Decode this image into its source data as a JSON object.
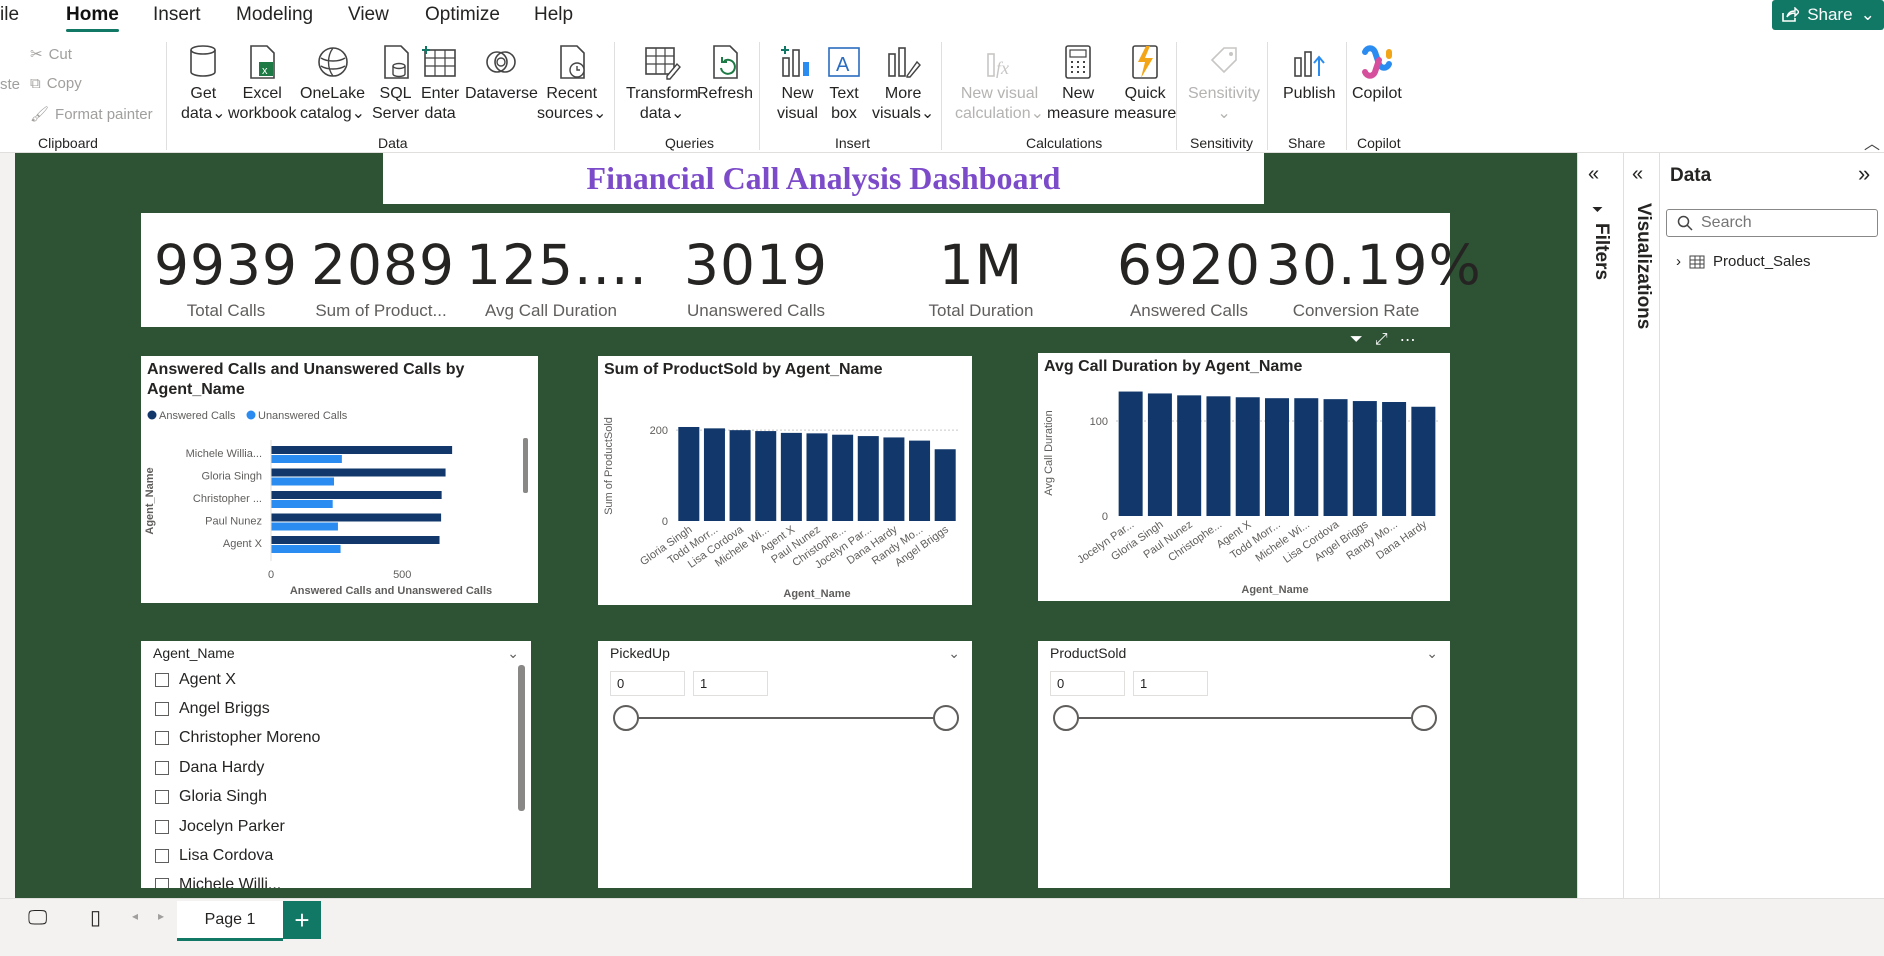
{
  "menu": {
    "file": "ile",
    "items": [
      "Home",
      "Insert",
      "Modeling",
      "View",
      "Optimize",
      "Help"
    ],
    "share": "Share"
  },
  "ribbon": {
    "clipboard": {
      "paste": "ste",
      "cut": "Cut",
      "copy": "Copy",
      "format_painter": "Format painter",
      "group": "Clipboard"
    },
    "data": {
      "get_data": [
        "Get",
        "data"
      ],
      "excel": [
        "Excel",
        "workbook"
      ],
      "onelake": [
        "OneLake",
        "catalog"
      ],
      "sql": [
        "SQL",
        "Server"
      ],
      "enter": [
        "Enter",
        "data"
      ],
      "dataverse": "Dataverse",
      "recent": [
        "Recent",
        "sources"
      ],
      "group": "Data"
    },
    "queries": {
      "transform": [
        "Transform",
        "data"
      ],
      "refresh": "Refresh",
      "group": "Queries"
    },
    "insert": {
      "new_visual": [
        "New",
        "visual"
      ],
      "text_box": [
        "Text",
        "box"
      ],
      "more_visuals": [
        "More",
        "visuals"
      ],
      "group": "Insert"
    },
    "calculations": {
      "new_visual_calc": [
        "New visual",
        "calculation"
      ],
      "new_measure": [
        "New",
        "measure"
      ],
      "quick_measure": [
        "Quick",
        "measure"
      ],
      "group": "Calculations"
    },
    "sensitivity": {
      "label": "Sensitivity",
      "group": "Sensitivity"
    },
    "share": {
      "publish": "Publish",
      "group": "Share"
    },
    "copilot": {
      "label": "Copilot",
      "group": "Copilot"
    }
  },
  "dashboard": {
    "title": "Financial Call Analysis Dashboard",
    "kpis": [
      {
        "value": "9939",
        "label": "Total Calls"
      },
      {
        "value": "2089",
        "label": "Sum of Product..."
      },
      {
        "value": "125....",
        "label": "Avg Call Duration"
      },
      {
        "value": "3019",
        "label": "Unanswered Calls"
      },
      {
        "value": "1M",
        "label": "Total Duration"
      },
      {
        "value": "6920",
        "label": "Answered Calls"
      },
      {
        "value": "30.19%",
        "label": "Conversion Rate"
      }
    ]
  },
  "chart_data": [
    {
      "type": "bar",
      "orientation": "horizontal",
      "title": "Answered Calls and Unanswered Calls by Agent_Name",
      "xlabel": "Answered Calls and Unanswered Calls",
      "ylabel": "Agent_Name",
      "legend": "top-left",
      "categories": [
        "Michele Willia...",
        "Gloria Singh",
        "Christopher ...",
        "Paul Nunez",
        "Agent X"
      ],
      "series": [
        {
          "name": "Answered Calls",
          "color": "#12386b",
          "values": [
            690,
            665,
            650,
            648,
            642
          ]
        },
        {
          "name": "Unanswered Calls",
          "color": "#2a8cf0",
          "values": [
            270,
            240,
            235,
            255,
            265
          ]
        }
      ],
      "xticks": [
        "0",
        "500"
      ],
      "xlim": [
        0,
        800
      ]
    },
    {
      "type": "bar",
      "title": "Sum of ProductSold by Agent_Name",
      "xlabel": "Agent_Name",
      "ylabel": "Sum of ProductSold",
      "categories": [
        "Gloria Singh",
        "Todd Morr...",
        "Lisa Cordova",
        "Michele Wi...",
        "Agent X",
        "Paul Nunez",
        "Christophe...",
        "Jocelyn Par...",
        "Dana Hardy",
        "Randy Mo...",
        "Angel Briggs"
      ],
      "values": [
        207,
        204,
        200,
        198,
        194,
        193,
        190,
        187,
        184,
        177,
        158
      ],
      "color": "#12386b",
      "yticks": [
        "0",
        "200"
      ],
      "ylim": [
        0,
        240
      ]
    },
    {
      "type": "bar",
      "title": "Avg Call Duration by Agent_Name",
      "xlabel": "Agent_Name",
      "ylabel": "Avg Call Duration",
      "categories": [
        "Jocelyn Par...",
        "Gloria Singh",
        "Paul Nunez",
        "Christophe...",
        "Agent X",
        "Todd Morr...",
        "Michele Wi...",
        "Lisa Cordova",
        "Angel Briggs",
        "Randy Mo...",
        "Dana Hardy"
      ],
      "values": [
        131,
        129,
        127,
        126,
        125,
        124,
        124,
        123,
        121,
        120,
        115
      ],
      "color": "#12386b",
      "yticks": [
        "0",
        "100"
      ],
      "ylim": [
        0,
        140
      ]
    }
  ],
  "slicers": {
    "agent": {
      "header": "Agent_Name",
      "items": [
        "Agent X",
        "Angel Briggs",
        "Christopher Moreno",
        "Dana Hardy",
        "Gloria Singh",
        "Jocelyn Parker",
        "Lisa Cordova",
        "Michele Willi..."
      ]
    },
    "pickedup": {
      "header": "PickedUp",
      "min": "0",
      "max": "1"
    },
    "productsold": {
      "header": "ProductSold",
      "min": "0",
      "max": "1"
    }
  },
  "panes": {
    "filters": "Filters",
    "visualizations": "Visualizations",
    "data_title": "Data",
    "search_placeholder": "Search",
    "table": "Product_Sales"
  },
  "pages": {
    "tab": "Page 1",
    "add": "+"
  }
}
